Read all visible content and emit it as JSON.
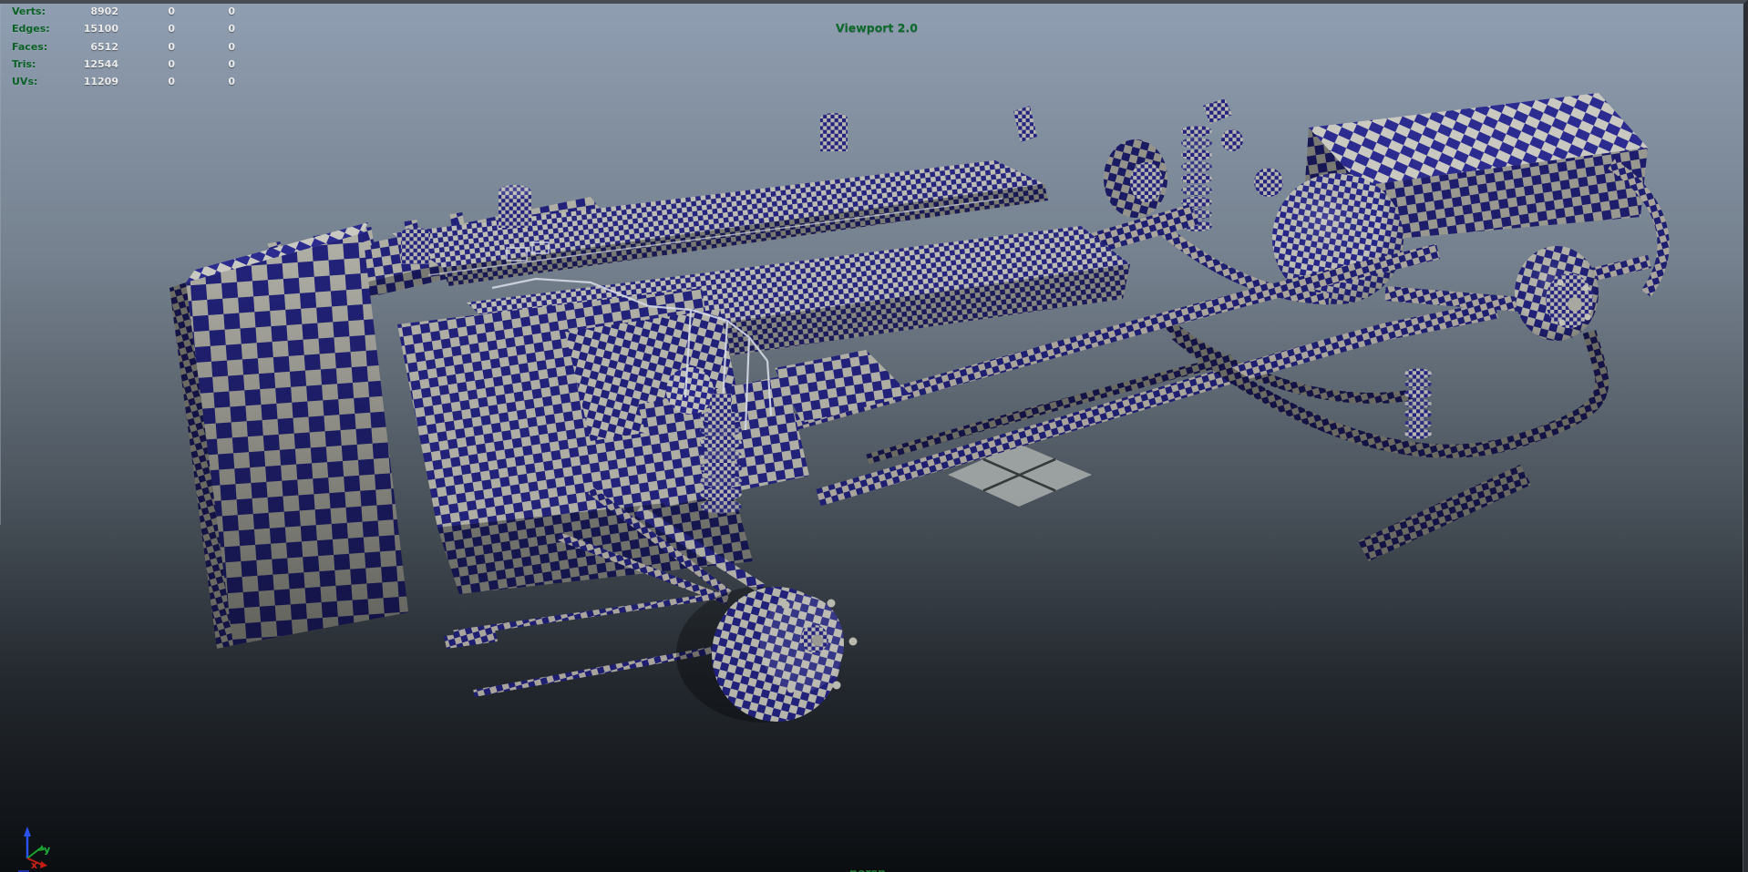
{
  "viewport": {
    "renderer_label": "Viewport 2.0",
    "camera_label": "persp"
  },
  "hud": {
    "rows": [
      {
        "label": "Verts:",
        "value": "8902",
        "col2": "0",
        "col3": "0"
      },
      {
        "label": "Edges:",
        "value": "15100",
        "col2": "0",
        "col3": "0"
      },
      {
        "label": "Faces:",
        "value": "6512",
        "col2": "0",
        "col3": "0"
      },
      {
        "label": "Tris:",
        "value": "12544",
        "col2": "0",
        "col3": "0"
      },
      {
        "label": "UVs:",
        "value": "11209",
        "col2": "0",
        "col3": "0"
      }
    ]
  },
  "gizmo": {
    "x_label": "x",
    "y_label": "y"
  },
  "colors": {
    "checker_blue": "#22227c",
    "checker_gray": "#b3b3aa",
    "bg_top": "#8e9db0",
    "bg_bottom": "#0b0e11",
    "hud_label_green": "#0b6226",
    "hud_value_white": "#ebebeb",
    "viewport_label_green": "#0c6b2b",
    "persp_label_green": "#1e7c35",
    "axis_x_red": "#cf2314",
    "axis_y_green": "#1db53a",
    "axis_z_blue": "#2a52f0"
  }
}
